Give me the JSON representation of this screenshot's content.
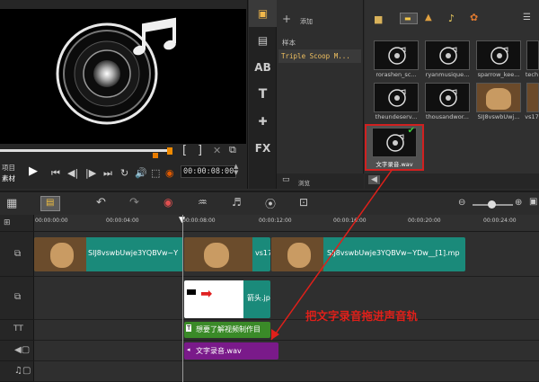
{
  "preview": {
    "mode_project": "项目",
    "mode_clip": "素材",
    "bracket_in": "[",
    "bracket_out": "]",
    "timecode": "00:00:08:00"
  },
  "library": {
    "add_label": "添加",
    "folders": [
      {
        "label": "样本",
        "selected": false
      },
      {
        "label": "Triple Scoop M...",
        "selected": true
      }
    ],
    "browse_label": "浏览",
    "tools": [
      {
        "label": "",
        "icon": "media-icon"
      },
      {
        "label": "",
        "icon": "instant-project-icon"
      },
      {
        "label": "AB",
        "icon": "transition-icon"
      },
      {
        "label": "T",
        "icon": "title-icon"
      },
      {
        "label": "",
        "icon": "graphics-icon"
      },
      {
        "label": "FX",
        "icon": "filter-icon"
      }
    ],
    "thumbs": [
      {
        "label": "rorashen_sc..."
      },
      {
        "label": "ryanmusique..."
      },
      {
        "label": "sparrow_kee..."
      },
      {
        "label": "tech"
      },
      {
        "label": "theundeserv..."
      },
      {
        "label": "thousandwor..."
      },
      {
        "label": "SIJ8vswbUwj..."
      },
      {
        "label": "vs17"
      },
      {
        "label": "文字录音.wav"
      }
    ]
  },
  "ruler": {
    "ticks": [
      "00:00:00:00",
      "00:00:04:00",
      "00:00:08:00",
      "00:00:12:00",
      "00:00:16:00",
      "00:00:20:00",
      "00:00:24:00"
    ]
  },
  "clips": {
    "video1": "SIJ8vswbUwje3YQBVw~Y",
    "video2": "vs17",
    "video3": "SIJ8vswbUwje3YQBVw~YDw__[1].mp",
    "overlay": "箭头.jp",
    "title": "想要了解视频制作目",
    "voice": "文字录音.wav"
  },
  "annotation": {
    "text": "把文字录音拖进声音轨",
    "color": "#e0201a"
  }
}
